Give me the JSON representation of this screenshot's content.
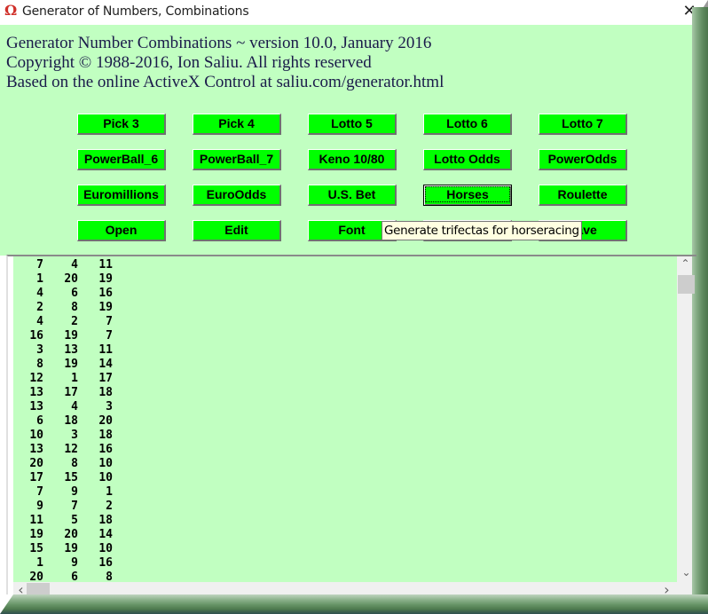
{
  "window": {
    "title": "Generator of Numbers, Combinations",
    "app_icon": "Ω",
    "close_glyph": "✕"
  },
  "header": {
    "lines": [
      "Generator Number Combinations ~ version 10.0, January 2016",
      "Copyright © 1988-2016, Ion Saliu. All rights reserved",
      "Based on the online ActiveX Control at saliu.com/generator.html"
    ]
  },
  "buttons": {
    "pick3": "Pick 3",
    "pick4": "Pick 4",
    "lotto5": "Lotto 5",
    "lotto6": "Lotto 6",
    "lotto7": "Lotto 7",
    "powerball6": "PowerBall_6",
    "powerball7": "PowerBall_7",
    "keno": "Keno 10/80",
    "lotto_odds": "Lotto Odds",
    "power_odds": "PowerOdds",
    "euromillions": "Euromillions",
    "euro_odds": "EuroOdds",
    "us_bet": "U.S. Bet",
    "horses": "Horses",
    "roulette": "Roulette",
    "open": "Open",
    "edit": "Edit",
    "font": "Font",
    "row4_col4": "",
    "save": "Save"
  },
  "colors": {
    "client_bg": "#c1ffc1",
    "button_bg": "#00ff00",
    "tooltip_bg": "#ffffe1"
  },
  "tooltip": "Generate trifectas for horseracing",
  "output": {
    "rows": [
      [
        7,
        4,
        11
      ],
      [
        1,
        20,
        19
      ],
      [
        4,
        6,
        16
      ],
      [
        2,
        8,
        19
      ],
      [
        4,
        2,
        7
      ],
      [
        16,
        19,
        7
      ],
      [
        3,
        13,
        11
      ],
      [
        8,
        19,
        14
      ],
      [
        12,
        1,
        17
      ],
      [
        13,
        17,
        18
      ],
      [
        13,
        4,
        3
      ],
      [
        6,
        18,
        20
      ],
      [
        10,
        3,
        18
      ],
      [
        13,
        12,
        16
      ],
      [
        20,
        8,
        10
      ],
      [
        17,
        15,
        10
      ],
      [
        7,
        9,
        1
      ],
      [
        9,
        7,
        2
      ],
      [
        11,
        5,
        18
      ],
      [
        19,
        20,
        14
      ],
      [
        15,
        19,
        10
      ],
      [
        1,
        9,
        16
      ],
      [
        20,
        6,
        8
      ]
    ]
  },
  "scrollbars": {
    "up": "⌃",
    "down": "⌄",
    "left": "‹",
    "right": "›"
  }
}
